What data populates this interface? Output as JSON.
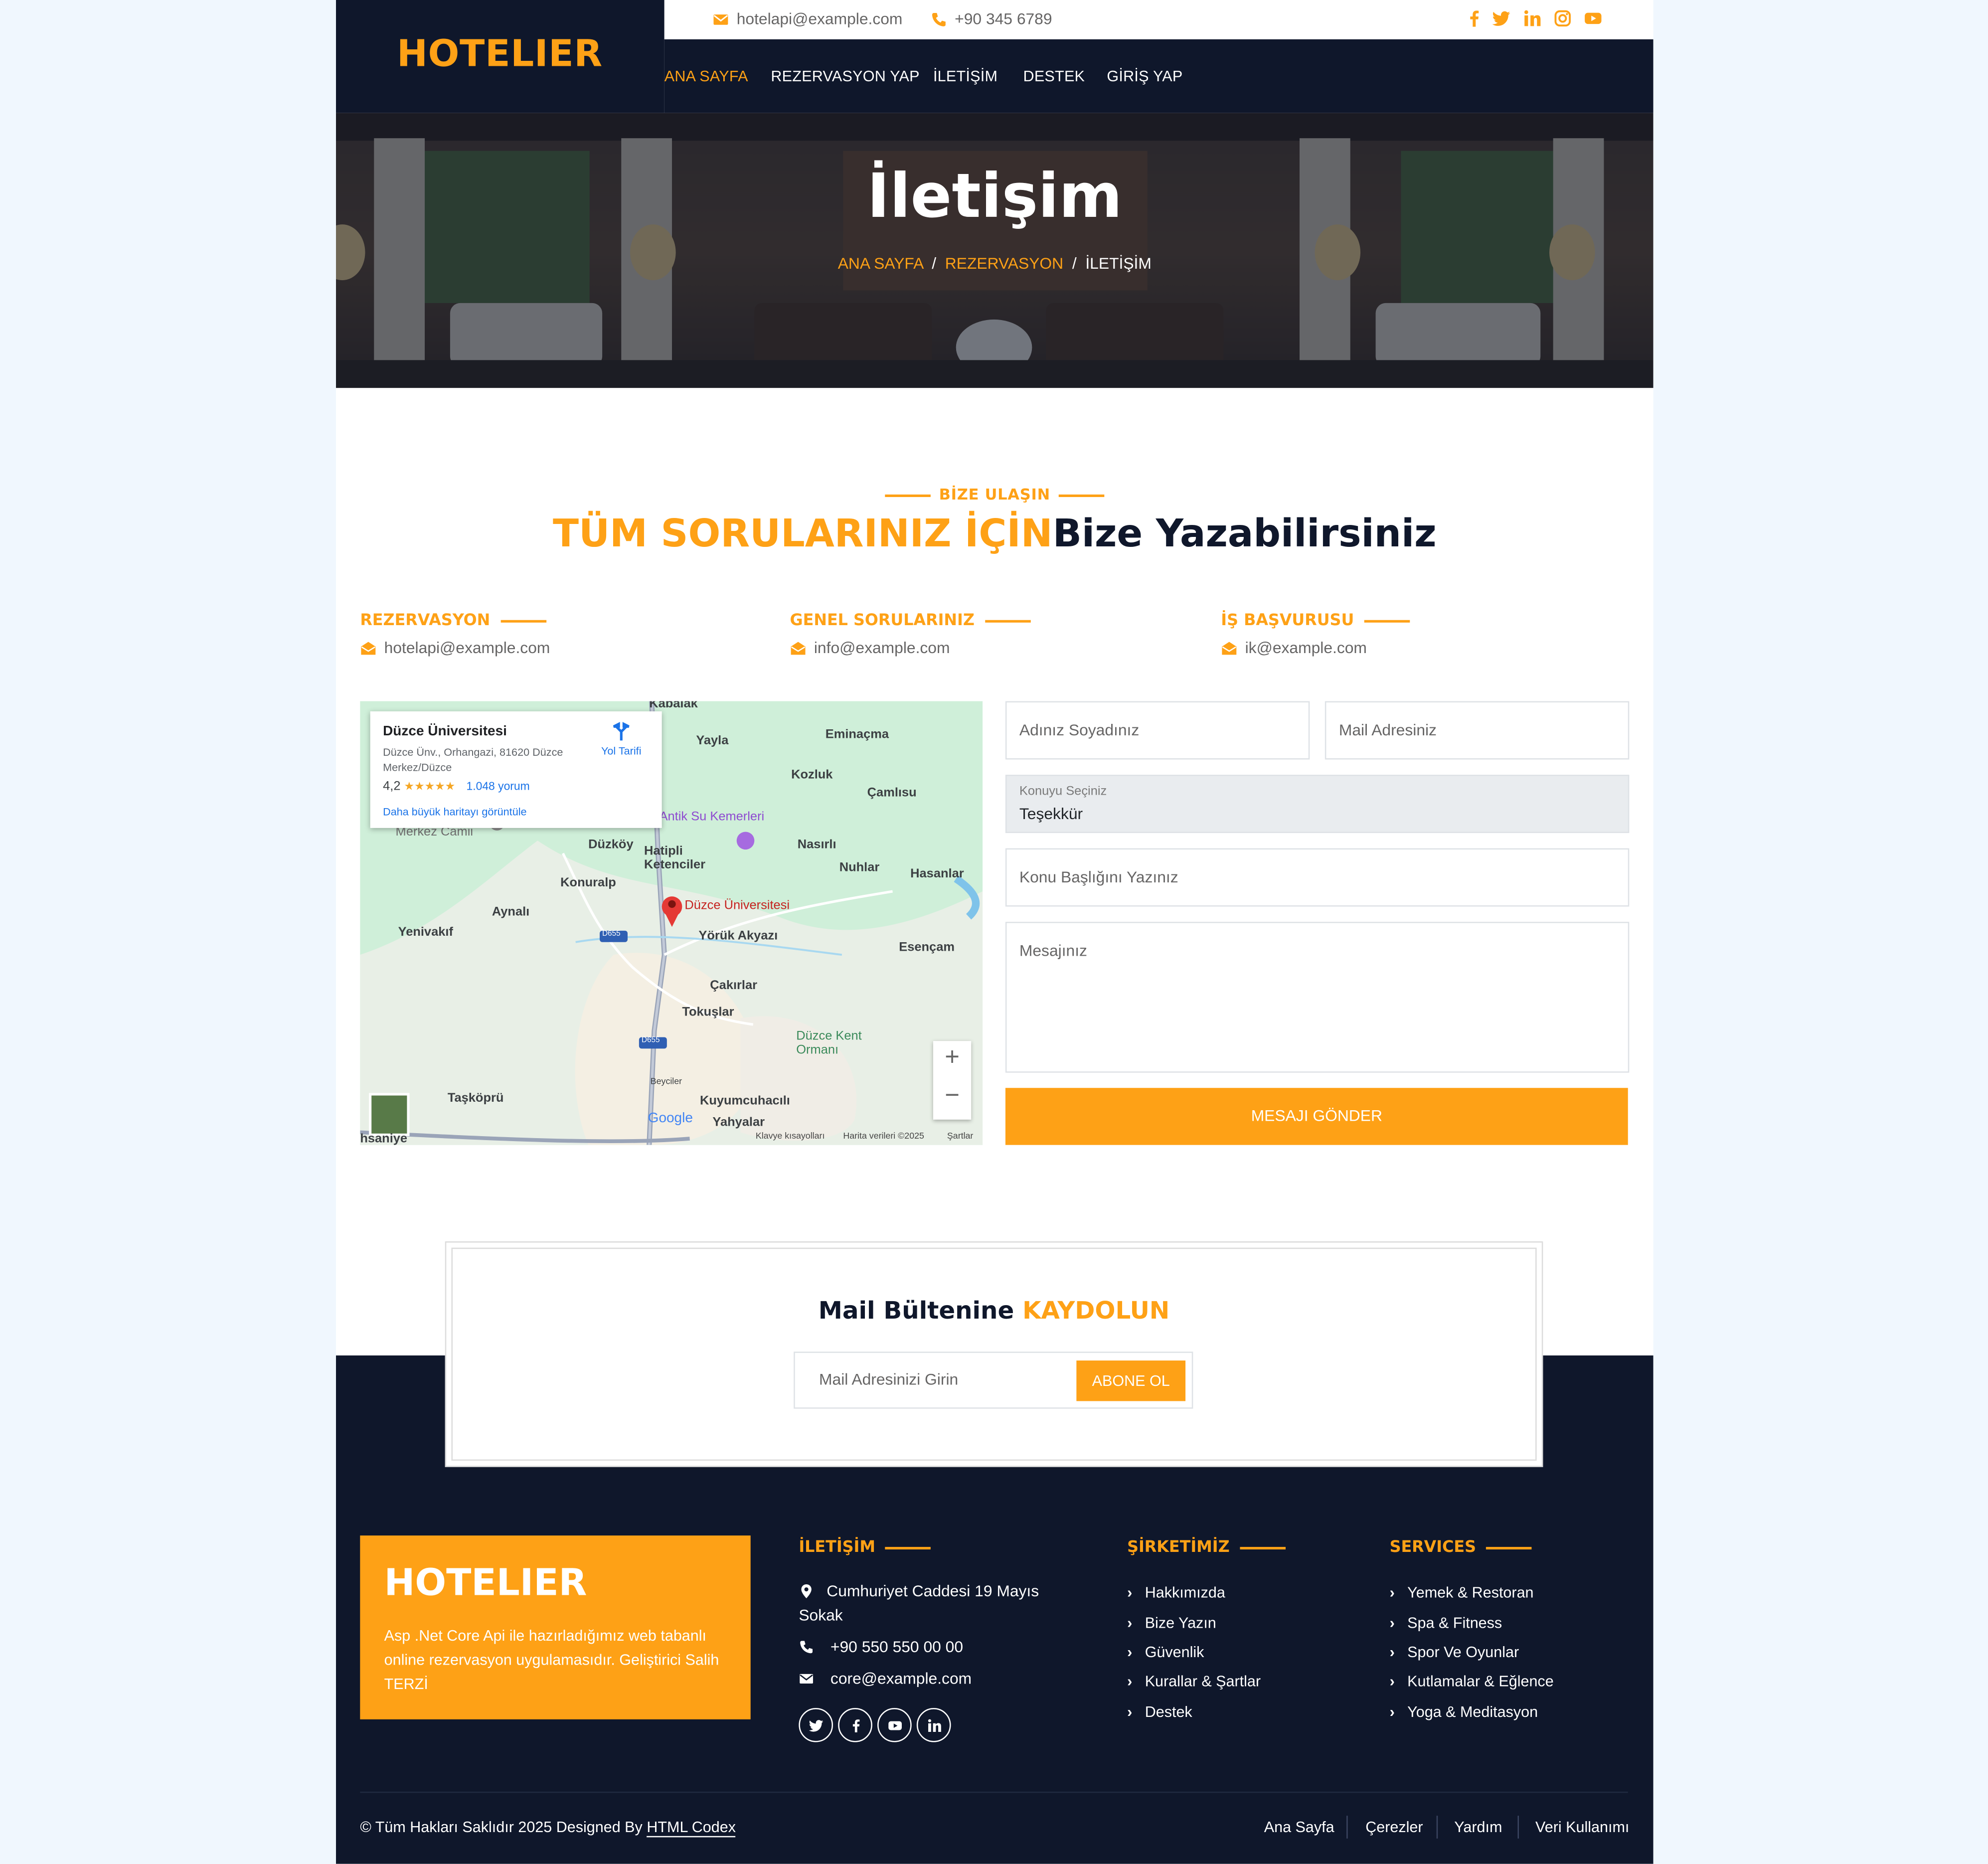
{
  "brand": "HOTELIER",
  "topbar": {
    "email": "hotelapi@example.com",
    "phone": "+90 345 6789"
  },
  "nav": [
    "ANA SAYFA",
    "REZERVASYON YAP",
    "İLETİŞİM",
    "DESTEK",
    "GİRİŞ YAP"
  ],
  "hero": {
    "title": "İletişim",
    "breadcrumb": [
      "ANA SAYFA",
      "REZERVASYON",
      "İLETİŞİM"
    ]
  },
  "section": {
    "eyebrow": "BİZE ULAŞIN",
    "title_accent": "TÜM SORULARINIZ İÇİN",
    "title_rest": "Bize Yazabilirsiniz"
  },
  "contacts": [
    {
      "label": "REZERVASYON",
      "email": "hotelapi@example.com"
    },
    {
      "label": "GENEL SORULARINIZ",
      "email": "info@example.com"
    },
    {
      "label": "İŞ BAŞVURUSU",
      "email": "ik@example.com"
    }
  ],
  "map": {
    "place_name": "Düzce Üniversitesi",
    "address": "Düzce Ünv., Orhangazi, 81620 Düzce Merkez/Düzce",
    "rating": "4,2",
    "stars": "★★★★★",
    "reviews": "1.048 yorum",
    "larger_map": "Daha büyük haritayı görüntüle",
    "directions": "Yol Tarifi",
    "marker_label": "Düzce Üniversitesi",
    "places": [
      "Kabalak",
      "Yayla",
      "Eminaçma",
      "Kozluk",
      "Çamlısu",
      "Antik Su Kemerleri",
      "Merkez Camii",
      "Düzköy",
      "Hatipli Ketenciler",
      "Nasırlı",
      "Nuhlar",
      "Hasanlar",
      "Konuralp",
      "Aynalı",
      "Yenivakıf",
      "Yörük Akyazı",
      "Esençam",
      "Çakırlar",
      "Tokuşlar",
      "Düzce Kent Ormanı",
      "Beyciler",
      "Taşköprü",
      "Kuyumcuhacılı",
      "Yahyalar",
      "hsaniye",
      "D655",
      "D655"
    ],
    "footer": [
      "Klavye kısayolları",
      "Harita verileri ©2025",
      "Şartlar"
    ],
    "logo": "Google",
    "zoom_in": "+",
    "zoom_out": "−"
  },
  "form": {
    "name_placeholder": "Adınız Soyadınız",
    "email_placeholder": "Mail Adresiniz",
    "subject_select_label": "Konuyu Seçiniz",
    "subject_select_value": "Teşekkür",
    "title_placeholder": "Konu Başlığını Yazınız",
    "message_placeholder": "Mesajınız",
    "submit": "MESAJI GÖNDER"
  },
  "newsletter": {
    "title": "Mail Bültenine",
    "title_accent": "KAYDOLUN",
    "placeholder": "Mail Adresinizi Girin",
    "button": "ABONE OL"
  },
  "footer": {
    "brand": "HOTELIER",
    "description": "Asp .Net Core Api ile hazırladığımız web tabanlı online rezervasyon uygulamasıdır. Geliştirici Salih TERZİ",
    "contact_heading": "İLETİŞİM",
    "address": "Cumhuriyet Caddesi 19 Mayıs Sokak",
    "phone": "+90 550 550 00 00",
    "email": "core@example.com",
    "company_heading": "ŞİRKETİMİZ",
    "company_links": [
      "Hakkımızda",
      "Bize Yazın",
      "Güvenlik",
      "Kurallar & Şartlar",
      "Destek"
    ],
    "services_heading": "SERVICES",
    "services_links": [
      "Yemek & Restoran",
      "Spa & Fitness",
      "Spor Ve Oyunlar",
      "Kutlamalar & Eğlence",
      "Yoga & Meditasyon"
    ],
    "copyright_prefix": "© Tüm Hakları Saklıdır 2025 Designed By",
    "copyright_link": "HTML Codex",
    "bottom_links": [
      "Ana Sayfa",
      "Çerezler",
      "Yardım",
      "Veri Kullanımı"
    ]
  },
  "colors": {
    "primary": "#FEA116",
    "dark": "#0F172B",
    "text": "#666565",
    "page_bg": "#F0F7FE"
  }
}
